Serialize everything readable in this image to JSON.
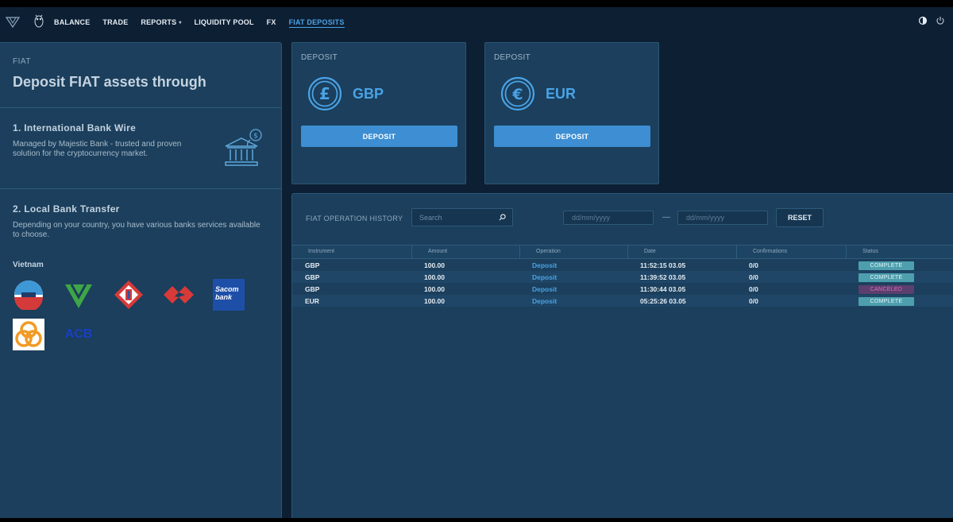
{
  "nav": {
    "items": [
      {
        "label": "BALANCE",
        "active": false
      },
      {
        "label": "TRADE",
        "active": false
      },
      {
        "label": "REPORTS",
        "active": false,
        "caret": "▾"
      },
      {
        "label": "LIQUIDITY POOL",
        "active": false
      },
      {
        "label": "FX",
        "active": false
      },
      {
        "label": "FIAT DEPOSITS",
        "active": true
      }
    ],
    "icons": [
      "logo-icon",
      "owl-icon",
      "theme-toggle-icon",
      "power-icon"
    ]
  },
  "left": {
    "kicker": "FIAT",
    "title": "Deposit FIAT assets through",
    "section1": {
      "title": "1.  International Bank Wire",
      "desc": "Managed by Majestic Bank - trusted and proven solution for the cryptocurrency market."
    },
    "section2": {
      "title": "2.  Local Bank Transfer",
      "desc": "Depending on your country, you have various banks services available to choose.",
      "country": "Vietnam",
      "banks": [
        {
          "name": "bank-1",
          "text": ""
        },
        {
          "name": "bank-2",
          "text": ""
        },
        {
          "name": "bank-3",
          "text": ""
        },
        {
          "name": "bank-4",
          "text": ""
        },
        {
          "name": "sacombank",
          "text": "Sacom bank"
        },
        {
          "name": "bank-6",
          "text": ""
        },
        {
          "name": "acb",
          "text": "ACB"
        }
      ]
    }
  },
  "cards": [
    {
      "kicker": "DEPOSIT",
      "currency": "GBP",
      "symbol": "£",
      "button": "DEPOSIT"
    },
    {
      "kicker": "DEPOSIT",
      "currency": "EUR",
      "symbol": "€",
      "button": "DEPOSIT"
    }
  ],
  "history": {
    "title": "FIAT OPERATION HISTORY",
    "search_placeholder": "Search",
    "date_placeholder": "dd/mm/yyyy",
    "dash": "—",
    "reset": "RESET",
    "columns": [
      "Instrument",
      "Amount",
      "Operation",
      "Date",
      "Confirmations",
      "Status"
    ],
    "rows": [
      {
        "instrument": "GBP",
        "amount": "100.00",
        "operation": "Deposit",
        "date": "11:52:15 03.05",
        "confirmations": "0/0",
        "status": "COMPLETE"
      },
      {
        "instrument": "GBP",
        "amount": "100.00",
        "operation": "Deposit",
        "date": "11:39:52 03.05",
        "confirmations": "0/0",
        "status": "COMPLETE"
      },
      {
        "instrument": "GBP",
        "amount": "100.00",
        "operation": "Deposit",
        "date": "11:30:44 03.05",
        "confirmations": "0/0",
        "status": "CANCELED"
      },
      {
        "instrument": "EUR",
        "amount": "100.00",
        "operation": "Deposit",
        "date": "05:25:26 03.05",
        "confirmations": "0/0",
        "status": "COMPLETE"
      }
    ]
  },
  "colors": {
    "background": "#0d1f33",
    "panel": "#1b3f5c",
    "accent": "#4aa3e6",
    "button": "#3d8ed2",
    "complete": "#4e9fae",
    "canceled": "#5b3f6e"
  }
}
